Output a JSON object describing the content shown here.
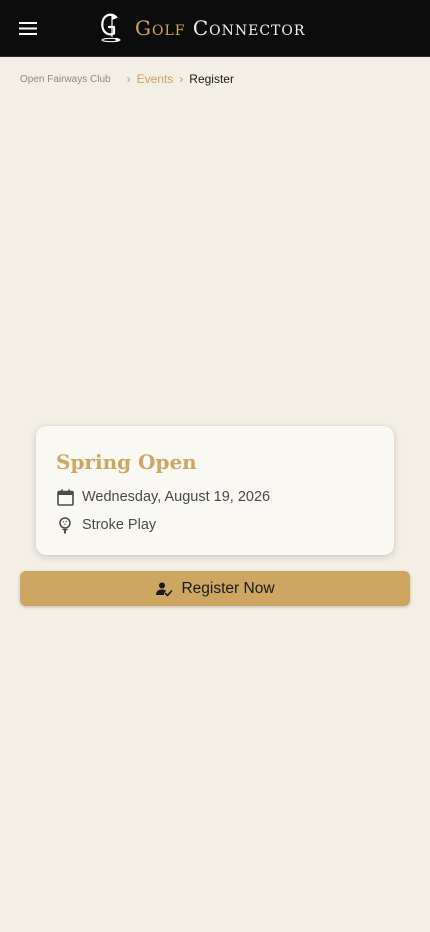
{
  "header": {
    "menu_icon": "menu-icon",
    "logo_icon": "golf-connector-logo",
    "brand_golf": "Golf",
    "brand_connector": "Connector"
  },
  "breadcrumb": {
    "home": "Open Fairways Club",
    "separator": "›",
    "events": "Events",
    "current": "Register"
  },
  "event": {
    "title": "Spring Open",
    "date_icon": "calendar-icon",
    "date": "Wednesday, August 19, 2026",
    "format_icon": "golf-ball-tee-icon",
    "format": "Stroke Play"
  },
  "action": {
    "icon": "person-check-icon",
    "label": "Register Now"
  },
  "colors": {
    "header_bg": "#0c0c0c",
    "page_bg": "#f4efe5",
    "accent_gold": "#cda661",
    "card_bg": "#faf8f3",
    "text_dark": "#1a1a1a"
  }
}
